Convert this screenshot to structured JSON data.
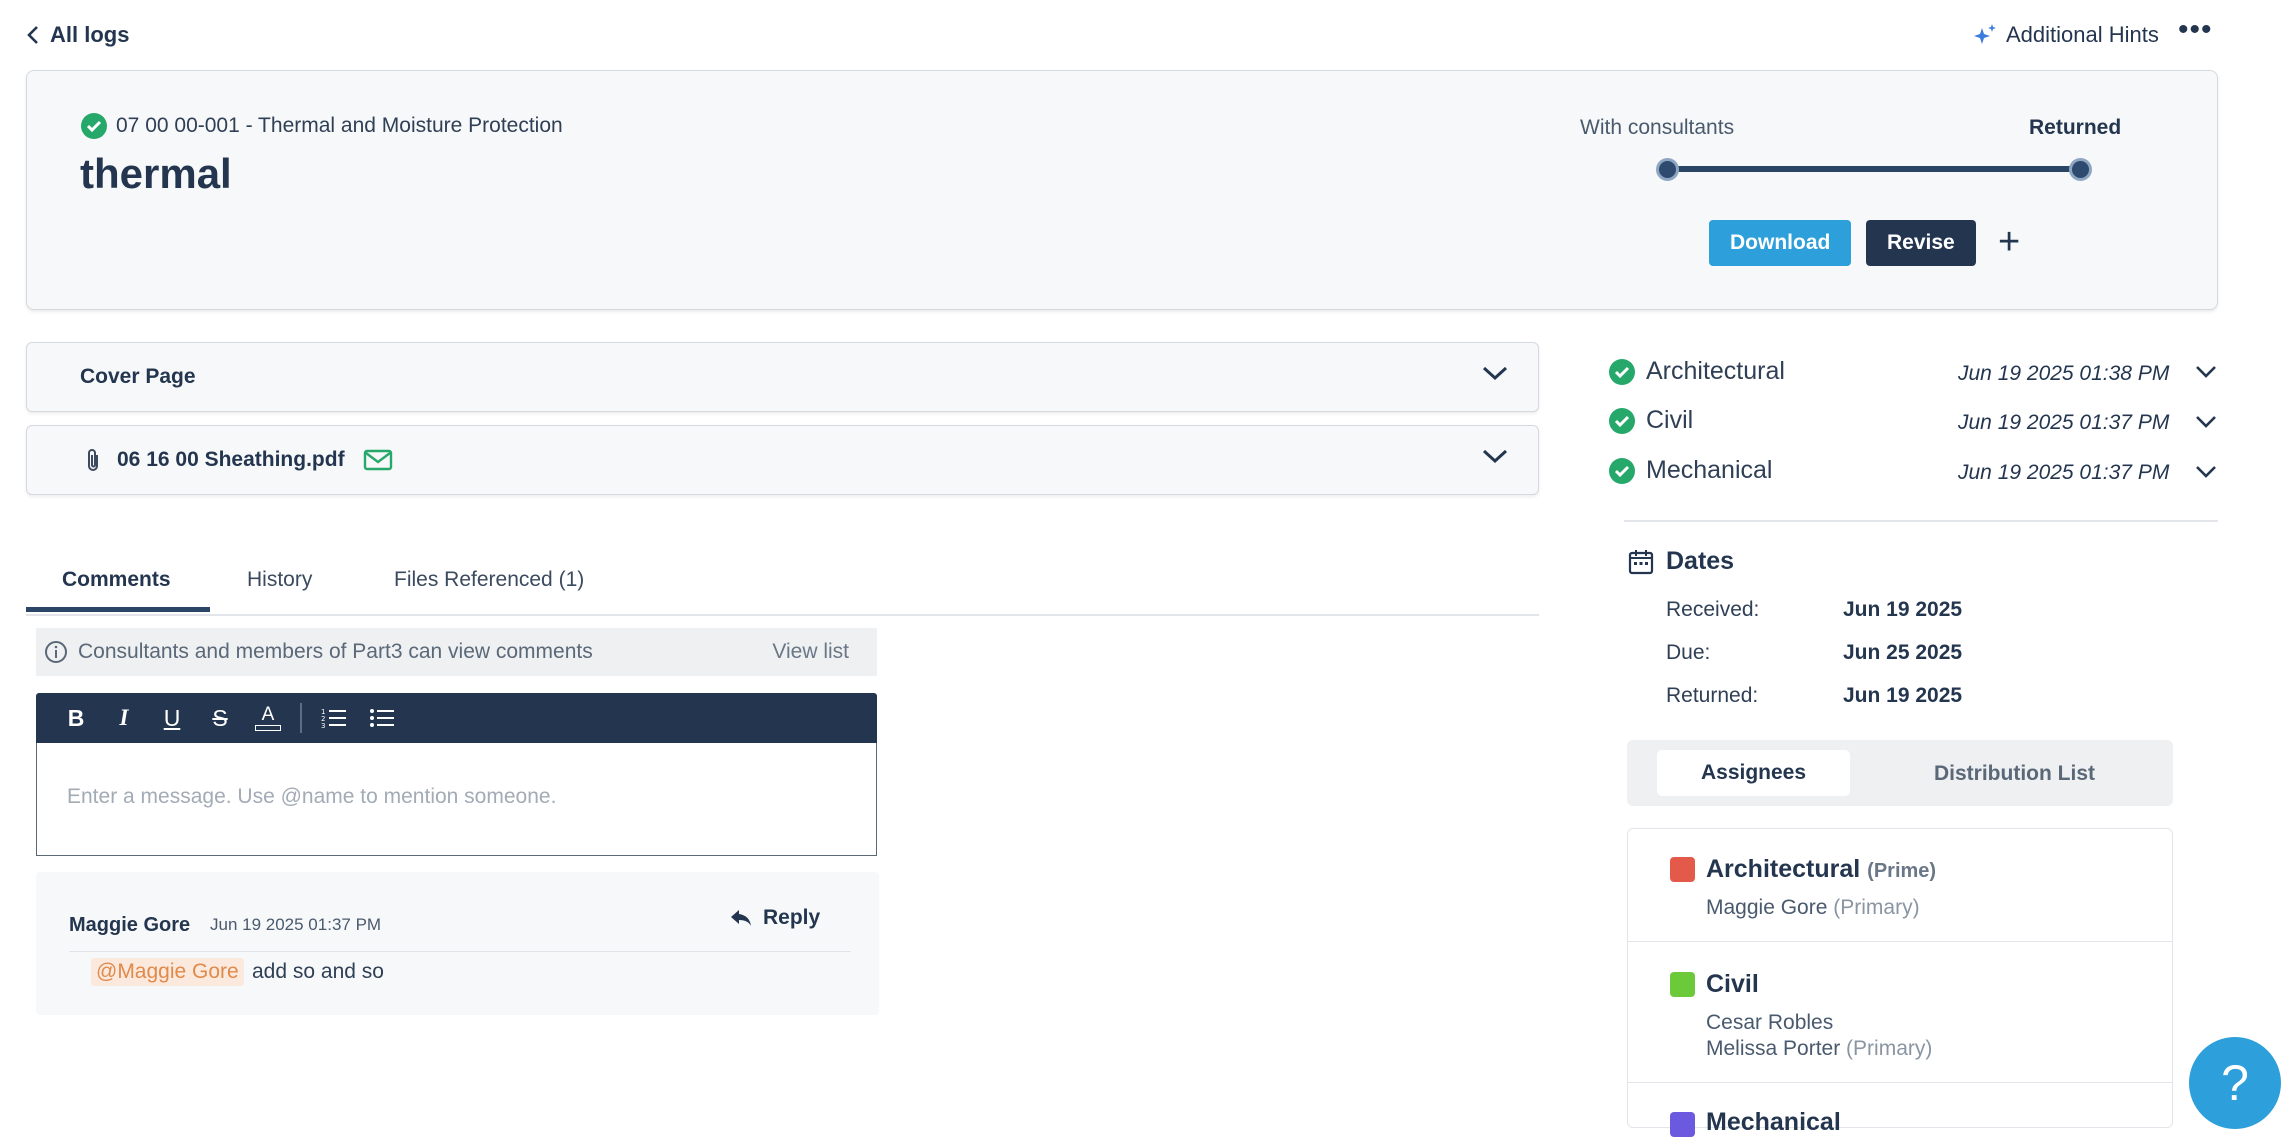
{
  "topbar": {
    "back_label": "All logs",
    "hints_label": "Additional Hints",
    "more_label": "•••"
  },
  "header": {
    "spec": "07 00 00-001 - Thermal and Moisture Protection",
    "title": "thermal",
    "progress": {
      "step_from": "With consultants",
      "step_to": "Returned",
      "current_step": 2,
      "total_steps": 2
    },
    "download_label": "Download",
    "revise_label": "Revise",
    "add_label": "+"
  },
  "accordions": {
    "cover_page": "Cover Page",
    "file_name": "06 16 00 Sheathing.pdf"
  },
  "tabs": {
    "comments": "Comments",
    "history": "History",
    "files": "Files Referenced (1)"
  },
  "comments": {
    "info": "Consultants and members of Part3 can view comments",
    "view_list": "View list",
    "placeholder": "Enter a message. Use @name to mention someone.",
    "toolbar": {
      "bold": "B",
      "italic": "I",
      "underline": "U",
      "strike": "S",
      "color": "A"
    },
    "items": [
      {
        "author": "Maggie Gore",
        "time": "Jun 19 2025 01:37 PM",
        "reply_label": "Reply",
        "mention": "@Maggie Gore",
        "text": "add so and so"
      }
    ]
  },
  "reviews": [
    {
      "discipline": "Architectural",
      "date": "Jun 19 2025 01:38 PM"
    },
    {
      "discipline": "Civil",
      "date": "Jun 19 2025 01:37 PM"
    },
    {
      "discipline": "Mechanical",
      "date": "Jun 19 2025 01:37 PM"
    }
  ],
  "dates": {
    "heading": "Dates",
    "received_label": "Received:",
    "received": "Jun 19 2025",
    "due_label": "Due:",
    "due": "Jun 25 2025",
    "returned_label": "Returned:",
    "returned": "Jun 19 2025"
  },
  "assignees": {
    "tab_active": "Assignees",
    "tab_other": "Distribution List",
    "groups": [
      {
        "name": "Architectural",
        "tag": "(Prime)",
        "color": "#e45a4a",
        "people": [
          {
            "name": "Maggie Gore",
            "role": "(Primary)"
          }
        ]
      },
      {
        "name": "Civil",
        "tag": "",
        "color": "#6cc93a",
        "people": [
          {
            "name": "Cesar Robles",
            "role": ""
          },
          {
            "name": "Melissa Porter",
            "role": "(Primary)"
          }
        ]
      },
      {
        "name": "Mechanical",
        "tag": "",
        "color": "#6b5ae0",
        "people": []
      }
    ]
  },
  "colors": {
    "navy": "#24364f",
    "accent_blue": "#2d9fda",
    "success_green": "#27a86b",
    "mention_bg": "#fbe9dd",
    "mention_text": "#e08a4c"
  },
  "help_label": "?"
}
